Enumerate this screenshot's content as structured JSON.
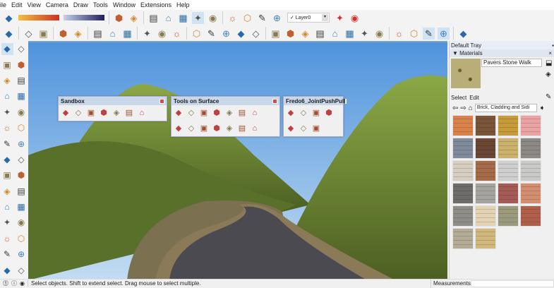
{
  "menu": [
    "ile",
    "Edit",
    "View",
    "Camera",
    "Draw",
    "Tools",
    "Window",
    "Extensions",
    "Help"
  ],
  "toolbar1": [
    "styles-icon",
    "shadow-month-slider",
    "shadow-time-slider",
    "xray-icon",
    "back-edges-icon",
    "wireframe-icon",
    "hidden-line-icon",
    "shaded-icon",
    "shaded-textures-icon",
    "monochrome-icon",
    "iso-view-icon",
    "top-view-icon",
    "front-view-icon",
    "right-view-icon"
  ],
  "layer": {
    "value": "✓ Layer0"
  },
  "toolbar1_end": [
    "shadows-icon",
    "section-icon"
  ],
  "toolbar2": [
    "select-circle-icon",
    "teapot-icon",
    "teapot-hand-icon",
    "image-export-icon",
    "image-icon",
    "window-icon",
    "window-copy-icon",
    "lock-icon",
    "model-info-icon",
    "component-icon",
    "paint-icon",
    "warehouse-icon",
    "box-add-icon",
    "box-explode-icon",
    "grass-icon",
    "trowel-icon",
    "funnel-icon",
    "target-icon",
    "protractor-icon",
    "umbrella-icon",
    "sun-icon",
    "dome-icon",
    "disk-icon",
    "light-icon",
    "orbit-icon",
    "section-cube-icon",
    "section-cube-2-icon",
    "section-cube-3-icon",
    "cursor-icon"
  ],
  "left_tools": [
    "select-icon",
    "eraser-icon",
    "paint-bucket-icon",
    "eraser-2-icon",
    "line-icon",
    "freehand-icon",
    "rectangle-icon",
    "rotated-rect-icon",
    "circle-icon",
    "polygon-icon",
    "arc-icon",
    "arc-2-icon",
    "pie-icon",
    "arc-3-icon",
    "push-pull-icon",
    "offset-icon",
    "move-icon",
    "rotate-icon",
    "follow-me-icon",
    "scale-icon",
    "tape-icon",
    "dimension-icon",
    "protractor-icon",
    "text-icon",
    "axes-icon",
    "3d-text-icon",
    "orbit-icon",
    "pan-icon",
    "zoom-icon",
    "zoom-extents-icon"
  ],
  "panels": {
    "sandbox": {
      "title": "Sandbox",
      "icons": [
        "from-contours",
        "from-scratch",
        "smoove",
        "stamp",
        "drape",
        "add-detail",
        "flip-edge"
      ]
    },
    "tos": {
      "title": "Tools on Surface",
      "row1": [
        "tos-erase",
        "tos-line",
        "tos-rect",
        "tos-circle",
        "tos-poly",
        "tos-ellipse",
        "tos-arc"
      ],
      "row2": [
        "tos-offset",
        "tos-freehand",
        "tos-polyline",
        "tos-push",
        "tos-select",
        "tos-paint",
        "tos-generate"
      ]
    },
    "fredo": {
      "title": "Fredo6_JointPushPull",
      "row1": [
        "joint-pp",
        "vector-pp",
        "normal-pp",
        "vertical-pp"
      ],
      "row2": [
        "extrude-pp",
        "follow-pp",
        "face-pp"
      ]
    }
  },
  "tray": {
    "title": "Default Tray",
    "section": "Materials",
    "material_name": "Pavers Stone Walk",
    "tab_select": "Select",
    "tab_edit": "Edit",
    "library": "Brick, Cladding and Sidi"
  },
  "swatches": [
    "#d9824a",
    "#7a5538",
    "#c79a3a",
    "#e9a3a3",
    "#7f8a9a",
    "#6a4634",
    "#cbb26c",
    "#8c8886",
    "#d6cfc1",
    "#a56b48",
    "#cfcfcf",
    "#c9c9c7",
    "#6e6c6a",
    "#a6a39e",
    "#a45a55",
    "#d28f70",
    "#8e8d88",
    "#e3d3b3",
    "#9c9a7c",
    "#b0604a",
    "#b3ab95",
    "#d0b77c"
  ],
  "status": {
    "text": "Select objects. Shift to extend select. Drag mouse to select multiple.",
    "measurements": "Measurements"
  }
}
